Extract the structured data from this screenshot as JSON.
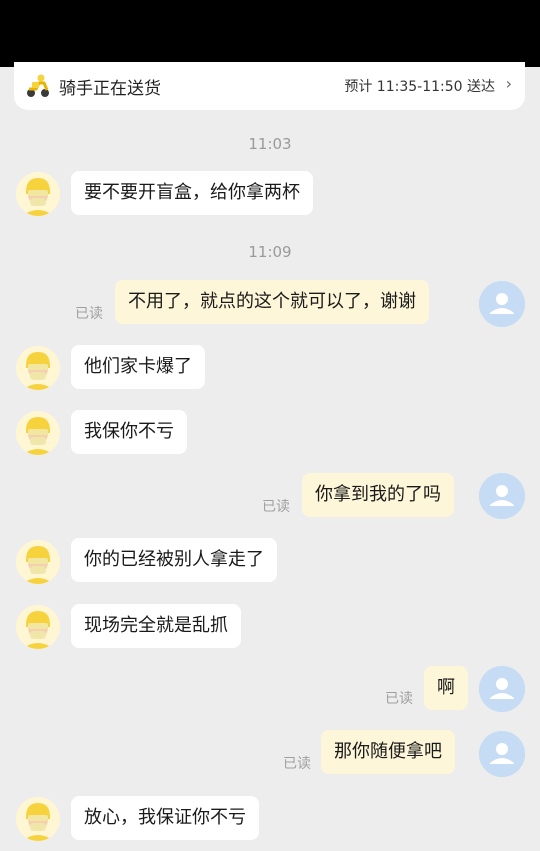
{
  "status_bar": {
    "title": "骑手正在送货",
    "eta": "预计 11:35-11:50 送达",
    "chevron": "›"
  },
  "timestamps": [
    "11:03",
    "11:09"
  ],
  "messages": [
    {
      "from": "rider",
      "text": "要不要开盲盒，给你拿两杯"
    },
    {
      "from": "me",
      "text": "不用了，就点的这个就可以了，谢谢",
      "read": "已读"
    },
    {
      "from": "rider",
      "text": "他们家卡爆了"
    },
    {
      "from": "rider",
      "text": "我保你不亏"
    },
    {
      "from": "me",
      "text": "你拿到我的了吗",
      "read": "已读"
    },
    {
      "from": "rider",
      "text": "你的已经被别人拿走了"
    },
    {
      "from": "rider",
      "text": "现场完全就是乱抓"
    },
    {
      "from": "me",
      "text": "啊",
      "read": "已读"
    },
    {
      "from": "me",
      "text": "那你随便拿吧",
      "read": "已读"
    },
    {
      "from": "rider",
      "text": "放心，我保证你不亏"
    }
  ],
  "icons": {
    "rider_status": "scooter-rider-icon",
    "rider_avatar": "rider-helmet-avatar",
    "my_avatar": "default-user-avatar"
  },
  "colors": {
    "background": "#ededed",
    "my_bubble": "#fdf6d8",
    "rider_bubble": "#ffffff",
    "my_avatar": "#c6dcf4",
    "rider_helmet": "#f6d23c"
  }
}
